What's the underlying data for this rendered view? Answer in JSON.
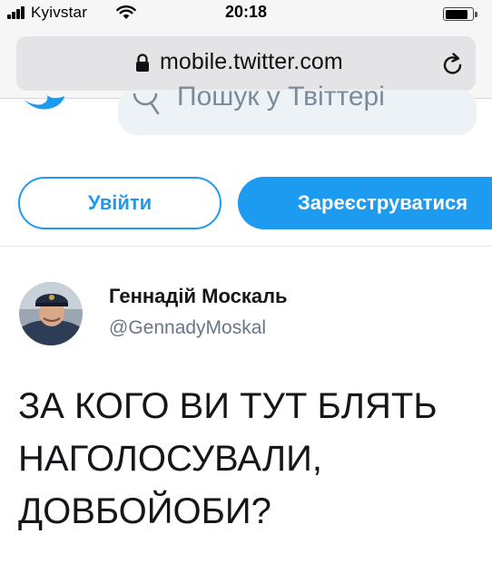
{
  "status_bar": {
    "carrier": "Kyivstar",
    "time": "20:18",
    "battery_level": 0.86
  },
  "browser": {
    "url": "mobile.twitter.com"
  },
  "twitter": {
    "search_placeholder": "Пошук у Твіттері",
    "login_label": "Увійти",
    "signup_label": "Зареєструватися",
    "tweet": {
      "author_name": "Геннадій Москаль",
      "author_handle": "@GennadyMoskal",
      "text_lines": [
        "ЗА КОГО ВИ ТУТ БЛЯТЬ",
        "НАГОЛОСУВАЛИ,",
        "ДОВБОЙОБИ?"
      ]
    }
  },
  "colors": {
    "twitter_blue": "#1d9bf0",
    "chrome_bg": "#f6f6f6",
    "text_primary": "#14171a",
    "text_secondary": "#687785"
  },
  "icons": {
    "signal": "signal-bars-icon",
    "wifi": "wifi-icon",
    "battery": "battery-icon",
    "lock": "lock-icon",
    "reload": "reload-icon",
    "logo": "twitter-bird-icon",
    "search": "search-icon"
  }
}
